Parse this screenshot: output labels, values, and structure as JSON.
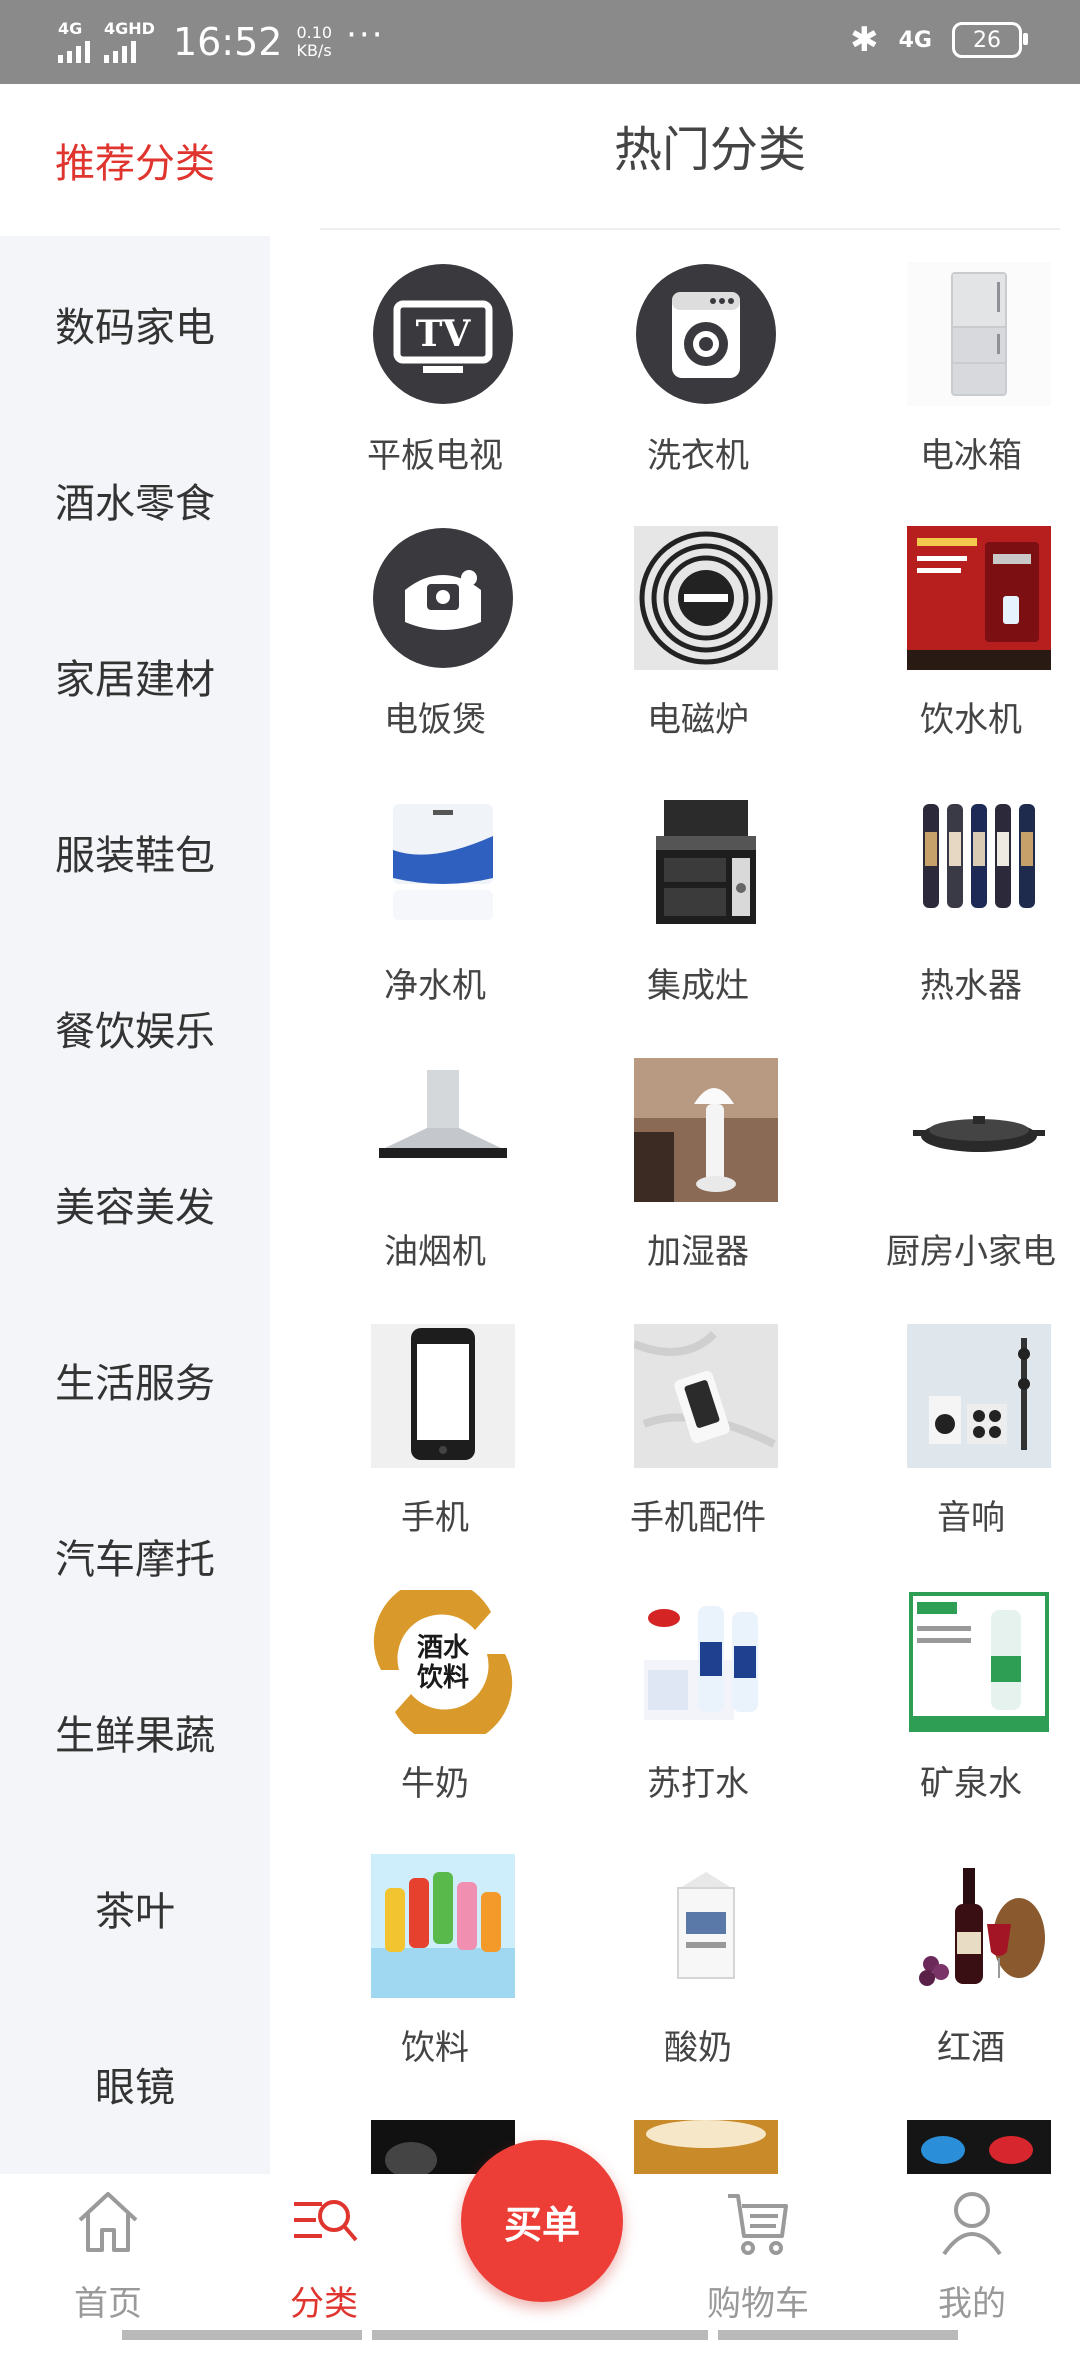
{
  "status_bar": {
    "sim1": "4G",
    "sim2": "4GHD",
    "time": "16:52",
    "speed_value": "0.10",
    "speed_unit": "KB/s",
    "more": "···",
    "bluetooth": "✱",
    "network": "4G",
    "battery": "26"
  },
  "sidebar": {
    "items": [
      {
        "label": "推荐分类"
      },
      {
        "label": "数码家电"
      },
      {
        "label": "酒水零食"
      },
      {
        "label": "家居建材"
      },
      {
        "label": "服装鞋包"
      },
      {
        "label": "餐饮娱乐"
      },
      {
        "label": "美容美发"
      },
      {
        "label": "生活服务"
      },
      {
        "label": "汽车摩托"
      },
      {
        "label": "生鲜果蔬"
      },
      {
        "label": "茶叶"
      },
      {
        "label": "眼镜"
      }
    ]
  },
  "main": {
    "title": "热门分类",
    "categories": [
      {
        "label": "平板电视",
        "icon": "tv-icon"
      },
      {
        "label": "洗衣机",
        "icon": "washing-machine-icon"
      },
      {
        "label": "电冰箱",
        "icon": "refrigerator-image"
      },
      {
        "label": "电饭煲",
        "icon": "rice-cooker-icon"
      },
      {
        "label": "电磁炉",
        "icon": "induction-cooker-icon"
      },
      {
        "label": "饮水机",
        "icon": "water-dispenser-image"
      },
      {
        "label": "净水机",
        "icon": "water-purifier-image"
      },
      {
        "label": "集成灶",
        "icon": "integrated-stove-image"
      },
      {
        "label": "热水器",
        "icon": "water-heater-image"
      },
      {
        "label": "油烟机",
        "icon": "range-hood-image"
      },
      {
        "label": "加湿器",
        "icon": "humidifier-image"
      },
      {
        "label": "厨房小家电",
        "icon": "grill-image"
      },
      {
        "label": "手机",
        "icon": "phone-image"
      },
      {
        "label": "手机配件",
        "icon": "phone-accessory-image"
      },
      {
        "label": "音响",
        "icon": "speaker-image"
      },
      {
        "label": "牛奶",
        "icon": "drinks-logo-image",
        "logo_text": "酒水饮料"
      },
      {
        "label": "苏打水",
        "icon": "soda-water-image"
      },
      {
        "label": "矿泉水",
        "icon": "mineral-water-image"
      },
      {
        "label": "饮料",
        "icon": "juice-bottles-image"
      },
      {
        "label": "酸奶",
        "icon": "yogurt-carton-image"
      },
      {
        "label": "红酒",
        "icon": "red-wine-image"
      }
    ]
  },
  "bottom_nav": {
    "home": "首页",
    "category": "分类",
    "buy": "买单",
    "cart": "购物车",
    "mine": "我的"
  },
  "colors": {
    "accent": "#e0342e",
    "sidebar_bg": "#f4f5f8",
    "statusbar_bg": "#8a8a8a"
  }
}
